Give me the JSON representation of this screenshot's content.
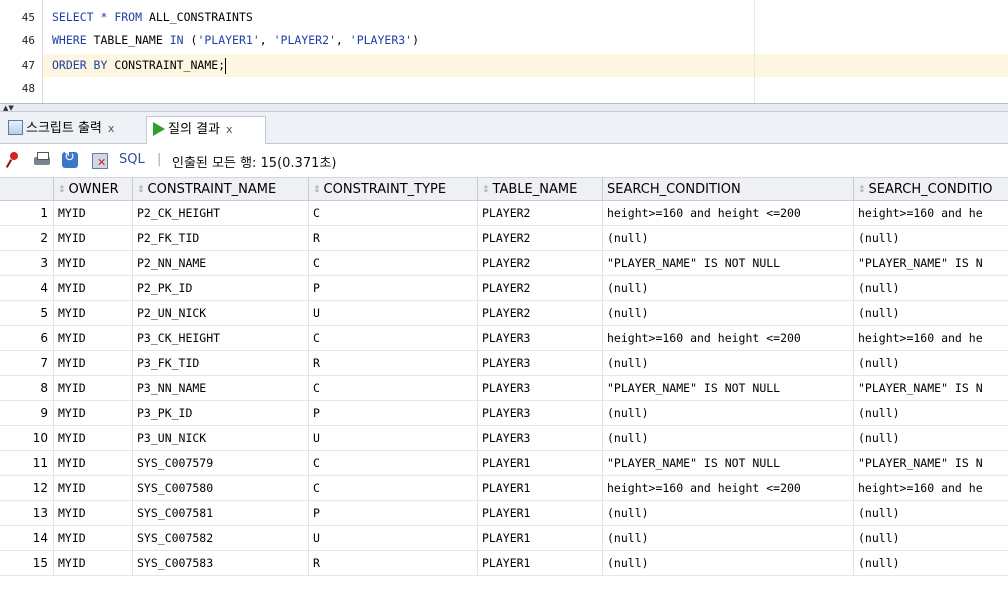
{
  "editor": {
    "lines": [
      {
        "num": "45",
        "parts": [
          [
            "kw",
            "SELECT "
          ],
          [
            "kw",
            "*"
          ],
          [
            "kw",
            " FROM "
          ],
          [
            "ident",
            "ALL_CONSTRAINTS"
          ]
        ]
      },
      {
        "num": "46",
        "parts": [
          [
            "kw",
            "WHERE "
          ],
          [
            "ident",
            "TABLE_NAME "
          ],
          [
            "kw",
            "IN "
          ],
          [
            "ident",
            "("
          ],
          [
            "str",
            "'PLAYER1'"
          ],
          [
            "ident",
            ", "
          ],
          [
            "str",
            "'PLAYER2'"
          ],
          [
            "ident",
            ", "
          ],
          [
            "str",
            "'PLAYER3'"
          ],
          [
            "ident",
            ")"
          ]
        ]
      },
      {
        "num": "47",
        "parts": [
          [
            "kw",
            "ORDER BY "
          ],
          [
            "ident",
            "CONSTRAINT_NAME;"
          ]
        ]
      },
      {
        "num": "48",
        "parts": []
      }
    ]
  },
  "tabs": {
    "script_output": "스크립트 출력",
    "query_result": "질의 결과",
    "close": "x"
  },
  "toolbar": {
    "sql_label": "SQL",
    "separator": "|",
    "status": "인출된 모든 행: 15(0.371초)"
  },
  "grid": {
    "columns": [
      "OWNER",
      "CONSTRAINT_NAME",
      "CONSTRAINT_TYPE",
      "TABLE_NAME",
      "SEARCH_CONDITION",
      "SEARCH_CONDITIO"
    ],
    "rows": [
      [
        "1",
        "MYID",
        "P2_CK_HEIGHT",
        "C",
        "PLAYER2",
        "height>=160 and height <=200",
        "height>=160 and he"
      ],
      [
        "2",
        "MYID",
        "P2_FK_TID",
        "R",
        "PLAYER2",
        "(null)",
        "(null)"
      ],
      [
        "3",
        "MYID",
        "P2_NN_NAME",
        "C",
        "PLAYER2",
        "\"PLAYER_NAME\" IS NOT NULL",
        "\"PLAYER_NAME\" IS N"
      ],
      [
        "4",
        "MYID",
        "P2_PK_ID",
        "P",
        "PLAYER2",
        "(null)",
        "(null)"
      ],
      [
        "5",
        "MYID",
        "P2_UN_NICK",
        "U",
        "PLAYER2",
        "(null)",
        "(null)"
      ],
      [
        "6",
        "MYID",
        "P3_CK_HEIGHT",
        "C",
        "PLAYER3",
        "height>=160 and height <=200",
        "height>=160 and he"
      ],
      [
        "7",
        "MYID",
        "P3_FK_TID",
        "R",
        "PLAYER3",
        "(null)",
        "(null)"
      ],
      [
        "8",
        "MYID",
        "P3_NN_NAME",
        "C",
        "PLAYER3",
        "\"PLAYER_NAME\" IS NOT NULL",
        "\"PLAYER_NAME\" IS N"
      ],
      [
        "9",
        "MYID",
        "P3_PK_ID",
        "P",
        "PLAYER3",
        "(null)",
        "(null)"
      ],
      [
        "10",
        "MYID",
        "P3_UN_NICK",
        "U",
        "PLAYER3",
        "(null)",
        "(null)"
      ],
      [
        "11",
        "MYID",
        "SYS_C007579",
        "C",
        "PLAYER1",
        "\"PLAYER_NAME\" IS NOT NULL",
        "\"PLAYER_NAME\" IS N"
      ],
      [
        "12",
        "MYID",
        "SYS_C007580",
        "C",
        "PLAYER1",
        "height>=160 and height <=200",
        "height>=160 and he"
      ],
      [
        "13",
        "MYID",
        "SYS_C007581",
        "P",
        "PLAYER1",
        "(null)",
        "(null)"
      ],
      [
        "14",
        "MYID",
        "SYS_C007582",
        "U",
        "PLAYER1",
        "(null)",
        "(null)"
      ],
      [
        "15",
        "MYID",
        "SYS_C007583",
        "R",
        "PLAYER1",
        "(null)",
        "(null)"
      ]
    ]
  }
}
